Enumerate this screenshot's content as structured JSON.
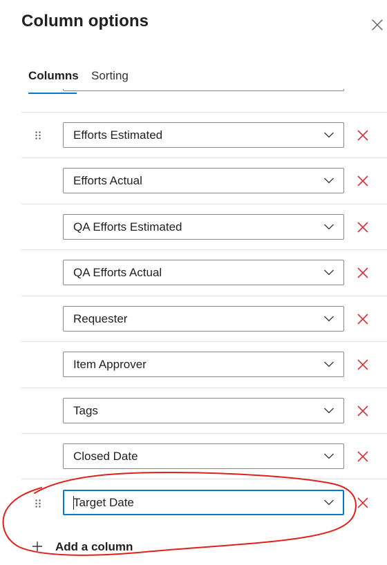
{
  "panel": {
    "title": "Column options"
  },
  "tabs": [
    {
      "label": "Columns",
      "selected": true
    },
    {
      "label": "Sorting",
      "selected": false
    }
  ],
  "columns": [
    {
      "label": ""
    },
    {
      "label": "Efforts Estimated"
    },
    {
      "label": "Efforts Actual"
    },
    {
      "label": "QA Efforts Estimated"
    },
    {
      "label": "QA Efforts Actual"
    },
    {
      "label": "Requester"
    },
    {
      "label": "Item Approver"
    },
    {
      "label": "Tags"
    },
    {
      "label": "Closed Date"
    },
    {
      "label": "Target Date",
      "focused": true
    }
  ],
  "add_column": {
    "label": "Add a column"
  },
  "icons": {
    "close": "close-icon",
    "drag": "drag-handle-icon",
    "chevron": "chevron-down-icon",
    "remove": "remove-x-icon",
    "add": "plus-icon"
  },
  "colors": {
    "accent": "#0078d4",
    "remove": "#d13438",
    "annotation": "#e0201b",
    "divider": "#e1dfdd"
  }
}
